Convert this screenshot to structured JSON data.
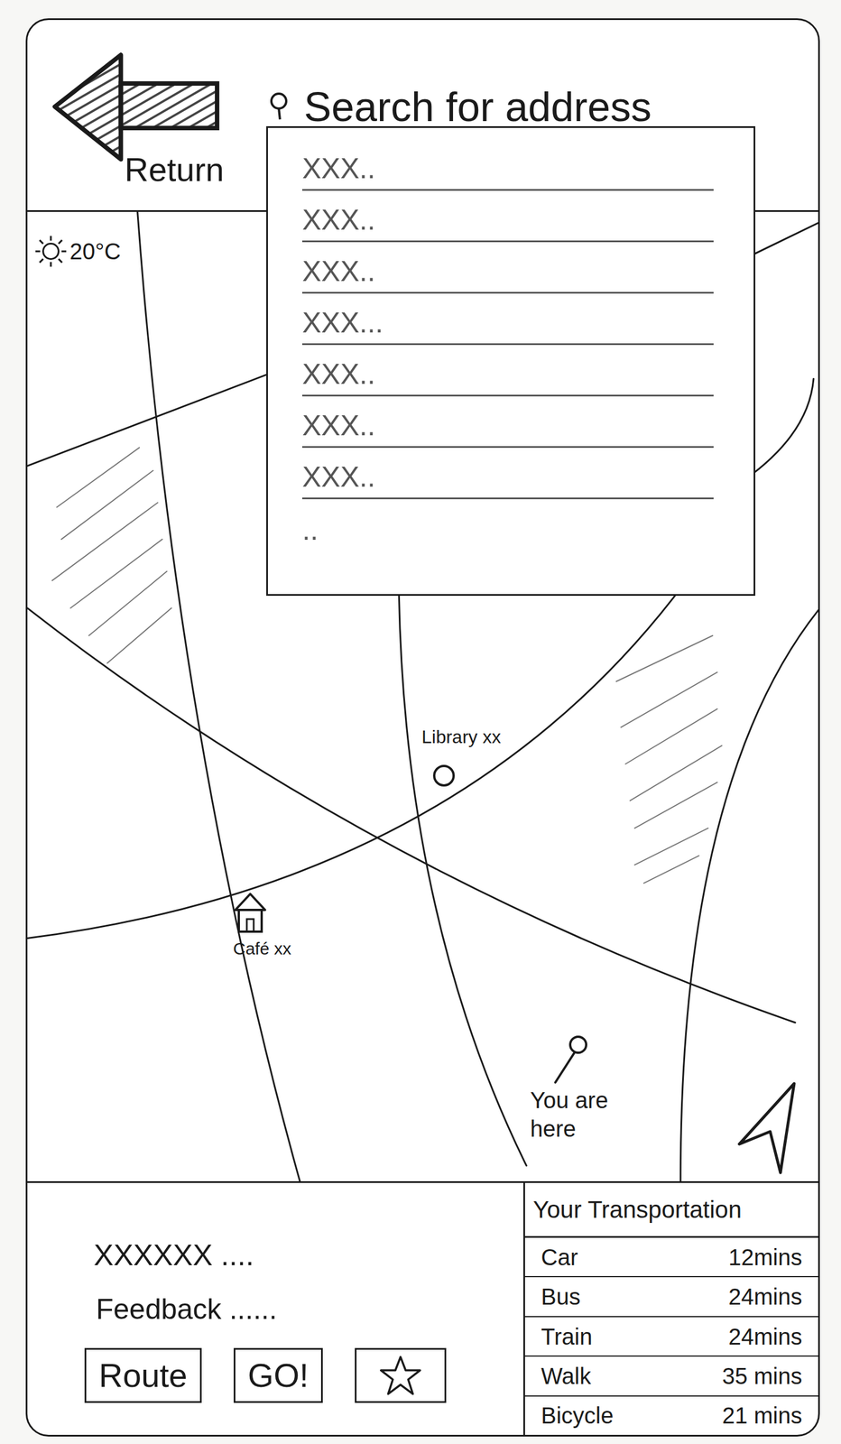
{
  "top_bar": {
    "return_label": "Return"
  },
  "search": {
    "placeholder": "Search for address",
    "suggestions": [
      "XXX..",
      "XXX..",
      "XXX..",
      "XXX...",
      "XXX..",
      "XXX..",
      "XXX..",
      ".."
    ]
  },
  "weather": {
    "temperature": "20°C"
  },
  "map": {
    "places": [
      {
        "label": "Library xx",
        "kind": "library"
      },
      {
        "label": "Café xx",
        "kind": "cafe"
      },
      {
        "label": "You are here",
        "kind": "location"
      }
    ]
  },
  "details": {
    "title": "XXXXXX ....",
    "feedback": "Feedback ......"
  },
  "buttons": [
    {
      "label": "Route"
    },
    {
      "label": "GO!"
    }
  ],
  "transportation": {
    "title": "Your Transportation",
    "modes": [
      {
        "mode": "Car",
        "time": "12mins"
      },
      {
        "mode": "Bus",
        "time": "24mins"
      },
      {
        "mode": "Train",
        "time": "24mins"
      },
      {
        "mode": "Walk",
        "time": "35 mins"
      },
      {
        "mode": "Bicycle",
        "time": "21 mins"
      }
    ]
  }
}
